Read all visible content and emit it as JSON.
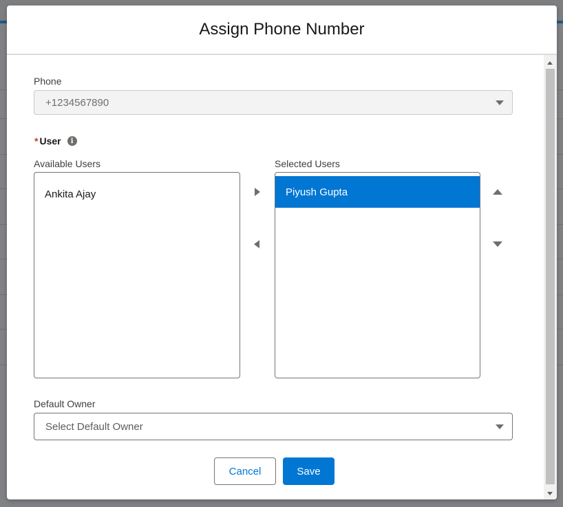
{
  "modal": {
    "title": "Assign Phone Number",
    "phone": {
      "label": "Phone",
      "value": "+1234567890"
    },
    "user": {
      "required_marker": "*",
      "label": "User",
      "info_icon_glyph": "i"
    },
    "available_users": {
      "label": "Available Users",
      "items": [
        "Ankita Ajay"
      ]
    },
    "selected_users": {
      "label": "Selected Users",
      "items": [
        "Piyush Gupta"
      ]
    },
    "default_owner": {
      "label": "Default Owner",
      "placeholder": "Select Default Owner"
    },
    "buttons": {
      "cancel": "Cancel",
      "save": "Save"
    }
  },
  "colors": {
    "brand": "#0176d3",
    "required": "#c23934",
    "overlay": "#808184"
  },
  "icons": [
    "move-right-icon",
    "move-left-icon",
    "move-up-icon",
    "move-down-icon",
    "chevron-down-icon",
    "info-icon"
  ]
}
